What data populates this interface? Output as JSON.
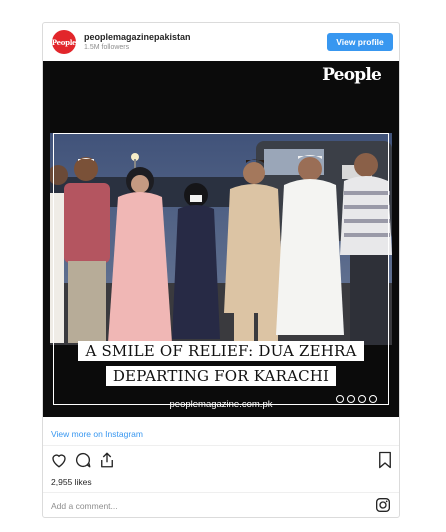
{
  "post": {
    "account": "peoplemagazinepakistan",
    "followers": "1.5M followers",
    "avatar_text": "People",
    "view_profile": "View profile"
  },
  "media": {
    "brand": "People",
    "caption_line1": "A SMILE OF RELIEF: DUA ZEHRA",
    "caption_line2": "DEPARTING FOR KARACHI",
    "site": "peoplemagazine.com.pk"
  },
  "footer": {
    "view_more": "View more on Instagram",
    "likes": "2,955 likes",
    "add_comment": "Add a comment..."
  },
  "icons": [
    "heart-icon",
    "comment-icon",
    "share-icon",
    "bookmark-icon",
    "instagram-icon"
  ],
  "colors": {
    "accent": "#3897f0",
    "avatar": "#e2262b"
  }
}
